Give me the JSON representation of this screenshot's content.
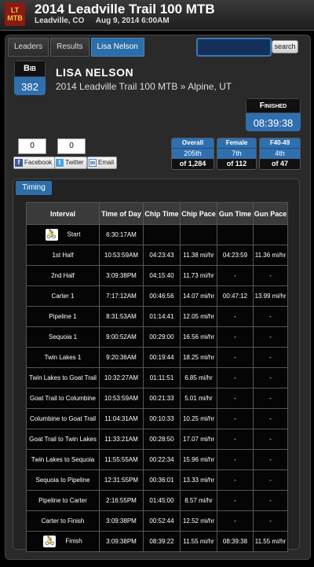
{
  "header": {
    "logo_text": "LT MTB",
    "title": "2014 Leadville Trail 100 MTB",
    "location": "Leadville, CO",
    "datetime": "Aug 9, 2014 6:00AM"
  },
  "nav": {
    "tabs": [
      {
        "label": "Leaders"
      },
      {
        "label": "Results"
      },
      {
        "label": "Lisa Nelson"
      }
    ],
    "search_value": "",
    "search_button": "search"
  },
  "athlete": {
    "bib_label": "Bib",
    "bib_number": "382",
    "name": "LISA NELSON",
    "race_line": "2014 Leadville Trail 100 MTB » Alpine, UT"
  },
  "finished": {
    "label": "Finished",
    "time": "08:39:38"
  },
  "social": {
    "facebook_count": "0",
    "twitter_count": "0",
    "facebook_label": "Facebook",
    "twitter_label": "Twitter",
    "email_label": "Email"
  },
  "placements": [
    {
      "label": "Overall",
      "place": "205th",
      "of": "of 1,284"
    },
    {
      "label": "Female",
      "place": "7th",
      "of": "of 112"
    },
    {
      "label": "F40-49",
      "place": "4th",
      "of": "of 47"
    }
  ],
  "timing": {
    "tab_label": "Timing",
    "columns": [
      "Interval",
      "Time of Day",
      "Chip Time",
      "Chip Pace",
      "Gun Time",
      "Gun Pace"
    ],
    "rows": [
      {
        "interval": "Start",
        "tod": "6:30:17AM",
        "chip": "",
        "chip_pace": "",
        "gun": "",
        "gun_pace": "",
        "icon": true
      },
      {
        "interval": "1st Half",
        "tod": "10:53:59AM",
        "chip": "04:23:43",
        "chip_pace": "11.38 mi/hr",
        "gun": "04:23:59",
        "gun_pace": "11.36 mi/hr"
      },
      {
        "interval": "2nd Half",
        "tod": "3:09:38PM",
        "chip": "04:15:40",
        "chip_pace": "11.73 mi/hr",
        "gun": "-",
        "gun_pace": "-"
      },
      {
        "interval": "Carter 1",
        "tod": "7:17:12AM",
        "chip": "00:46:56",
        "chip_pace": "14.07 mi/hr",
        "gun": "00:47:12",
        "gun_pace": "13.99 mi/hr"
      },
      {
        "interval": "Pipeline 1",
        "tod": "8:31:53AM",
        "chip": "01:14:41",
        "chip_pace": "12.05 mi/hr",
        "gun": "-",
        "gun_pace": "-"
      },
      {
        "interval": "Sequoia 1",
        "tod": "9:00:52AM",
        "chip": "00:29:00",
        "chip_pace": "16.56 mi/hr",
        "gun": "-",
        "gun_pace": "-"
      },
      {
        "interval": "Twin Lakes 1",
        "tod": "9:20:36AM",
        "chip": "00:19:44",
        "chip_pace": "18.25 mi/hr",
        "gun": "-",
        "gun_pace": "-"
      },
      {
        "interval": "Twin Lakes to Goat Trail",
        "tod": "10:32:27AM",
        "chip": "01:11:51",
        "chip_pace": "6.85 mi/hr",
        "gun": "-",
        "gun_pace": "-"
      },
      {
        "interval": "Goat Trail to Columbine",
        "tod": "10:53:59AM",
        "chip": "00:21:33",
        "chip_pace": "5.01 mi/hr",
        "gun": "-",
        "gun_pace": "-"
      },
      {
        "interval": "Columbine to Goat Trail",
        "tod": "11:04:31AM",
        "chip": "00:10:33",
        "chip_pace": "10.25 mi/hr",
        "gun": "-",
        "gun_pace": "-"
      },
      {
        "interval": "Goat Trail to Twin Lakes",
        "tod": "11:33:21AM",
        "chip": "00:28:50",
        "chip_pace": "17.07 mi/hr",
        "gun": "-",
        "gun_pace": "-"
      },
      {
        "interval": "Twin Lakes to Sequoia",
        "tod": "11:55:55AM",
        "chip": "00:22:34",
        "chip_pace": "15.96 mi/hr",
        "gun": "-",
        "gun_pace": "-"
      },
      {
        "interval": "Sequoia to Pipeline",
        "tod": "12:31:55PM",
        "chip": "00:36:01",
        "chip_pace": "13.33 mi/hr",
        "gun": "-",
        "gun_pace": "-"
      },
      {
        "interval": "Pipeline to Carter",
        "tod": "2:16:55PM",
        "chip": "01:45:00",
        "chip_pace": "8.57 mi/hr",
        "gun": "-",
        "gun_pace": "-"
      },
      {
        "interval": "Carter to Finish",
        "tod": "3:09:38PM",
        "chip": "00:52:44",
        "chip_pace": "12.52 mi/hr",
        "gun": "-",
        "gun_pace": "-"
      },
      {
        "interval": "Finish",
        "tod": "3:09:38PM",
        "chip": "08:39:22",
        "chip_pace": "11.55 mi/hr",
        "gun": "08:39:38",
        "gun_pace": "11.55 mi/hr",
        "icon": true
      }
    ]
  },
  "colors": {
    "accent": "#2f6fae",
    "header_bg": "#2a2a2a",
    "logo": "#8a1a12"
  },
  "icons": {
    "cyclist": "bicycle-icon"
  }
}
